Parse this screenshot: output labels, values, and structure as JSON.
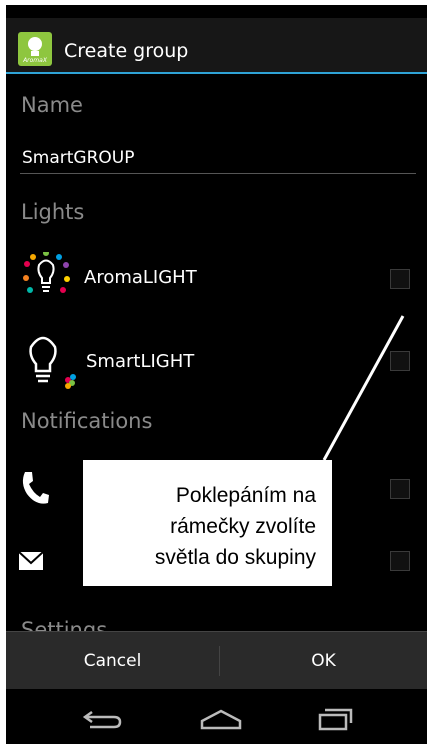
{
  "app": {
    "title": "Create group",
    "icon_tag": "AromaX"
  },
  "name_section": {
    "label": "Name",
    "value": "SmartGROUP"
  },
  "lights_section": {
    "label": "Lights",
    "items": [
      {
        "label": "AromaLIGHT",
        "icon": "aroma-bulb-icon",
        "checked": false
      },
      {
        "label": "SmartLIGHT",
        "icon": "smart-bulb-icon",
        "checked": false
      }
    ]
  },
  "notifications_section": {
    "label": "Notifications",
    "items": [
      {
        "icon": "phone-icon",
        "checked": false
      },
      {
        "icon": "envelope-icon",
        "checked": false
      }
    ]
  },
  "settings_section": {
    "label": "Settings"
  },
  "callout": {
    "lines": [
      "Poklepáním na",
      "rámečky zvolíte",
      "světla do skupiny"
    ]
  },
  "buttons": {
    "cancel": "Cancel",
    "ok": "OK"
  },
  "navbar": {
    "icons": [
      "back-icon",
      "home-icon",
      "recent-apps-icon"
    ]
  },
  "colors": {
    "accent": "#2fa3d6",
    "app_icon": "#8ec63f"
  }
}
